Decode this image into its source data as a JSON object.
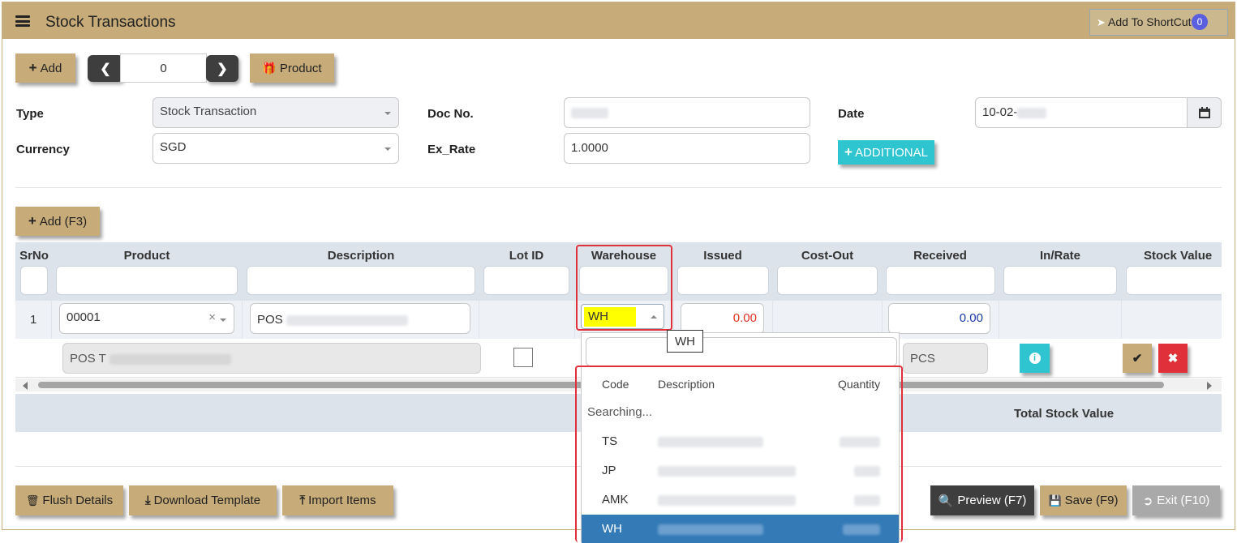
{
  "app": {
    "title": "Stock Transactions",
    "shortcut_label": "Add To ShortCut",
    "shortcut_count": "0"
  },
  "toolbar": {
    "add_label": "Add",
    "record_number": "0",
    "product_label": "Product"
  },
  "form": {
    "type_label": "Type",
    "type_value": "Stock Transaction",
    "currency_label": "Currency",
    "currency_value": "SGD",
    "docno_label": "Doc No.",
    "exrate_label": "Ex_Rate",
    "exrate_value": "1.0000",
    "date_label": "Date",
    "date_value": "10-02-",
    "additional_label": "ADDITIONAL"
  },
  "grid": {
    "add_row_label": "Add (F3)",
    "columns": [
      "SrNo",
      "Product",
      "Description",
      "Lot ID",
      "Warehouse",
      "Issued",
      "Cost-Out",
      "Received",
      "In/Rate",
      "Stock Value"
    ],
    "row": {
      "srno": "1",
      "product": "00001",
      "description_prefix": "POS",
      "warehouse": "WH",
      "issued": "0.00",
      "received": "0.00",
      "detail_description_prefix": "POS T",
      "uom": "PCS"
    },
    "total_label": "Total Stock Value",
    "tooltip": "WH"
  },
  "dropdown": {
    "headers": {
      "code": "Code",
      "description": "Description",
      "quantity": "Quantity"
    },
    "status": "Searching...",
    "options": [
      {
        "code": "TS",
        "selected": false
      },
      {
        "code": "JP",
        "selected": false
      },
      {
        "code": "AMK",
        "selected": false
      },
      {
        "code": "WH",
        "selected": true
      }
    ]
  },
  "footer": {
    "flush_label": "Flush Details",
    "download_label": "Download Template",
    "import_label": "Import Items",
    "preview_label": "Preview (F7)",
    "save_label": "Save (F9)",
    "exit_label": "Exit (F10)"
  },
  "colors": {
    "header_tan": "#c7ab78",
    "teal": "#2ec4d0",
    "highlight_yellow": "#ffff00",
    "selected_blue": "#337ab7",
    "annotation_red": "#e0313a"
  }
}
